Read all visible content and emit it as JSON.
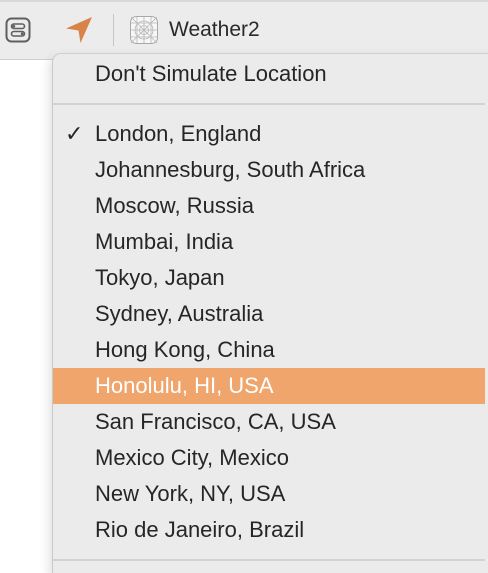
{
  "toolbar": {
    "scheme_icon": "toggle-list-icon",
    "location_icon": "location-arrow-icon",
    "location_color": "#d9834a",
    "project_icon": "app-icon-grid",
    "project_name": "Weather2"
  },
  "menu": {
    "top_item": "Don't Simulate Location",
    "checkmark": "✓",
    "locations": [
      "London, England",
      "Johannesburg, South Africa",
      "Moscow, Russia",
      "Mumbai, India",
      "Tokyo, Japan",
      "Sydney, Australia",
      "Hong Kong, China",
      "Honolulu, HI, USA",
      "San Francisco, CA, USA",
      "Mexico City, Mexico",
      "New York, NY, USA",
      "Rio de Janeiro, Brazil"
    ],
    "checked_location": "London, England",
    "highlighted_location": "Honolulu, HI, USA",
    "highlight_color": "#efa56b"
  }
}
